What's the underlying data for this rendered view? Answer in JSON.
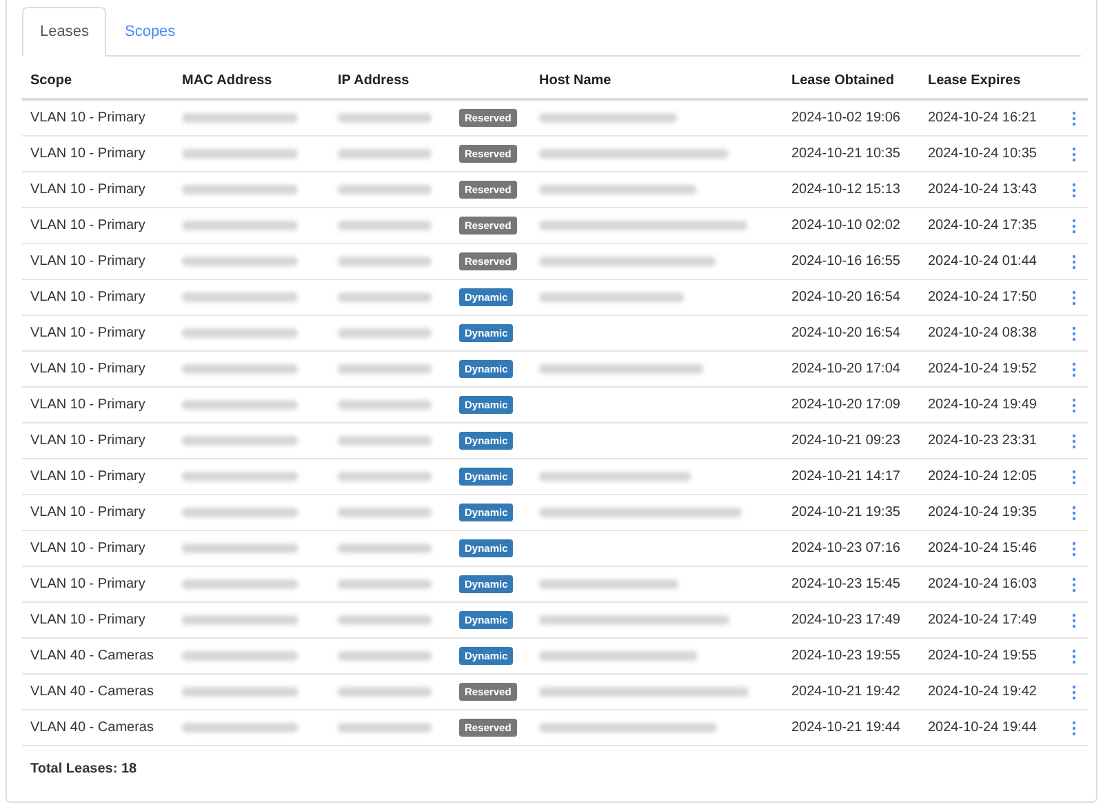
{
  "tabs": [
    {
      "label": "Leases",
      "selected": true
    },
    {
      "label": "Scopes",
      "selected": false
    }
  ],
  "table": {
    "columns": [
      "Scope",
      "MAC Address",
      "IP Address",
      "Host Name",
      "Lease Obtained",
      "Lease Expires"
    ],
    "rows": [
      {
        "scope": "VLAN 10 - Primary",
        "type": "Reserved",
        "kind": "reserved",
        "host_shown": true,
        "obtained": "2024-10-02 19:06",
        "expires": "2024-10-24 16:21"
      },
      {
        "scope": "VLAN 10 - Primary",
        "type": "Reserved",
        "kind": "reserved",
        "host_shown": true,
        "obtained": "2024-10-21 10:35",
        "expires": "2024-10-24 10:35"
      },
      {
        "scope": "VLAN 10 - Primary",
        "type": "Reserved",
        "kind": "reserved",
        "host_shown": true,
        "obtained": "2024-10-12 15:13",
        "expires": "2024-10-24 13:43"
      },
      {
        "scope": "VLAN 10 - Primary",
        "type": "Reserved",
        "kind": "reserved",
        "host_shown": true,
        "obtained": "2024-10-10 02:02",
        "expires": "2024-10-24 17:35"
      },
      {
        "scope": "VLAN 10 - Primary",
        "type": "Reserved",
        "kind": "reserved",
        "host_shown": true,
        "obtained": "2024-10-16 16:55",
        "expires": "2024-10-24 01:44"
      },
      {
        "scope": "VLAN 10 - Primary",
        "type": "Dynamic",
        "kind": "dynamic",
        "host_shown": true,
        "obtained": "2024-10-20 16:54",
        "expires": "2024-10-24 17:50"
      },
      {
        "scope": "VLAN 10 - Primary",
        "type": "Dynamic",
        "kind": "dynamic",
        "host_shown": false,
        "obtained": "2024-10-20 16:54",
        "expires": "2024-10-24 08:38"
      },
      {
        "scope": "VLAN 10 - Primary",
        "type": "Dynamic",
        "kind": "dynamic",
        "host_shown": true,
        "obtained": "2024-10-20 17:04",
        "expires": "2024-10-24 19:52"
      },
      {
        "scope": "VLAN 10 - Primary",
        "type": "Dynamic",
        "kind": "dynamic",
        "host_shown": false,
        "obtained": "2024-10-20 17:09",
        "expires": "2024-10-24 19:49"
      },
      {
        "scope": "VLAN 10 - Primary",
        "type": "Dynamic",
        "kind": "dynamic",
        "host_shown": false,
        "obtained": "2024-10-21 09:23",
        "expires": "2024-10-23 23:31"
      },
      {
        "scope": "VLAN 10 - Primary",
        "type": "Dynamic",
        "kind": "dynamic",
        "host_shown": true,
        "obtained": "2024-10-21 14:17",
        "expires": "2024-10-24 12:05"
      },
      {
        "scope": "VLAN 10 - Primary",
        "type": "Dynamic",
        "kind": "dynamic",
        "host_shown": true,
        "obtained": "2024-10-21 19:35",
        "expires": "2024-10-24 19:35"
      },
      {
        "scope": "VLAN 10 - Primary",
        "type": "Dynamic",
        "kind": "dynamic",
        "host_shown": false,
        "obtained": "2024-10-23 07:16",
        "expires": "2024-10-24 15:46"
      },
      {
        "scope": "VLAN 10 - Primary",
        "type": "Dynamic",
        "kind": "dynamic",
        "host_shown": true,
        "obtained": "2024-10-23 15:45",
        "expires": "2024-10-24 16:03"
      },
      {
        "scope": "VLAN 10 - Primary",
        "type": "Dynamic",
        "kind": "dynamic",
        "host_shown": true,
        "obtained": "2024-10-23 17:49",
        "expires": "2024-10-24 17:49"
      },
      {
        "scope": "VLAN 40 - Cameras",
        "type": "Dynamic",
        "kind": "dynamic",
        "host_shown": true,
        "obtained": "2024-10-23 19:55",
        "expires": "2024-10-24 19:55"
      },
      {
        "scope": "VLAN 40 - Cameras",
        "type": "Reserved",
        "kind": "reserved",
        "host_shown": true,
        "obtained": "2024-10-21 19:42",
        "expires": "2024-10-24 19:42"
      },
      {
        "scope": "VLAN 40 - Cameras",
        "type": "Reserved",
        "kind": "reserved",
        "host_shown": true,
        "obtained": "2024-10-21 19:44",
        "expires": "2024-10-24 19:44"
      }
    ]
  },
  "total": "Total Leases: 18"
}
